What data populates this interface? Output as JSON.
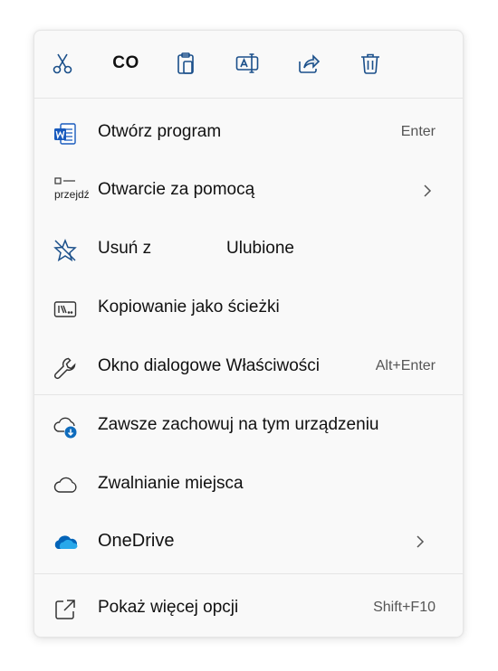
{
  "toolbar": {
    "copy_label": "CO"
  },
  "items": [
    {
      "label": "Otwórz program",
      "shortcut": "Enter",
      "icon": "word-doc-icon"
    },
    {
      "label": "Otwarcie za pomocą",
      "prefix": "przejdź",
      "icon": "open-with-icon",
      "submenu": true
    },
    {
      "label_a": "Usuń z",
      "label_b": "Ulubione",
      "icon": "unpin-star-icon"
    },
    {
      "label": "Kopiowanie jako ścieżki",
      "icon": "copy-path-icon"
    },
    {
      "label": "Okno dialogowe Właściwości",
      "shortcut": "Alt+Enter",
      "icon": "wrench-icon"
    },
    {
      "label": "Zawsze zachowuj na tym urządzeniu",
      "icon": "cloud-download-icon"
    },
    {
      "label": "Zwalnianie miejsca",
      "icon": "cloud-icon"
    },
    {
      "label": "OneDrive",
      "icon": "onedrive-icon",
      "submenu": true
    },
    {
      "label": "Pokaż więcej opcji",
      "shortcut": "Shift+F10",
      "icon": "expand-icon"
    }
  ],
  "colors": {
    "accent": "#0f6cbd",
    "word_blue": "#185abd",
    "onedrive_blue": "#0364b8"
  }
}
